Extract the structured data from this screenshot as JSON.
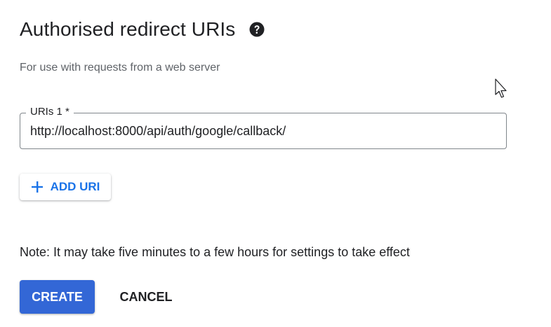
{
  "section": {
    "title": "Authorised redirect URIs",
    "subtitle": "For use with requests from a web server",
    "help_icon": "help-circle-icon"
  },
  "uri_field": {
    "label": "URIs 1 *",
    "value": "http://localhost:8000/api/auth/google/callback/"
  },
  "add_uri": {
    "label": "ADD URI",
    "icon": "plus-icon",
    "color": "#1a73e8"
  },
  "note": "Note: It may take five minutes to a few hours for settings to take effect",
  "actions": {
    "create_label": "CREATE",
    "cancel_label": "CANCEL",
    "primary_color": "#3367d6"
  }
}
